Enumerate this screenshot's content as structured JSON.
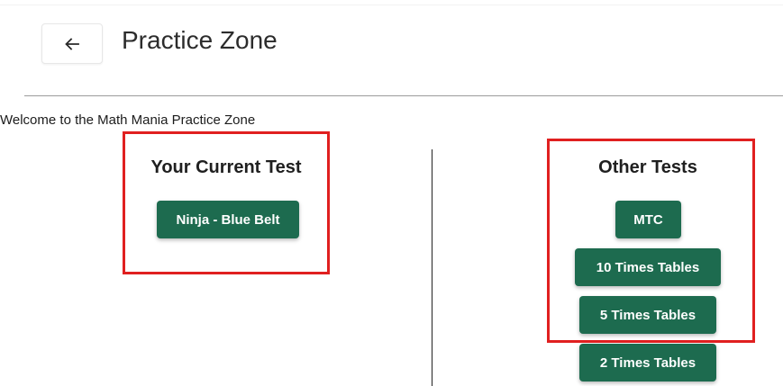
{
  "header": {
    "back_icon": "arrow-left-icon",
    "title": "Practice Zone"
  },
  "welcome_text": "Welcome to the Math Mania Practice Zone",
  "current_test": {
    "heading": "Your Current Test",
    "button_label": "Ninja - Blue Belt"
  },
  "other_tests": {
    "heading": "Other Tests",
    "buttons": [
      {
        "label": "MTC"
      },
      {
        "label": "10 Times Tables"
      },
      {
        "label": "5 Times Tables"
      },
      {
        "label": "2 Times Tables"
      }
    ]
  },
  "colors": {
    "button_green": "#1d6b4f",
    "highlight_red": "#e02020"
  }
}
